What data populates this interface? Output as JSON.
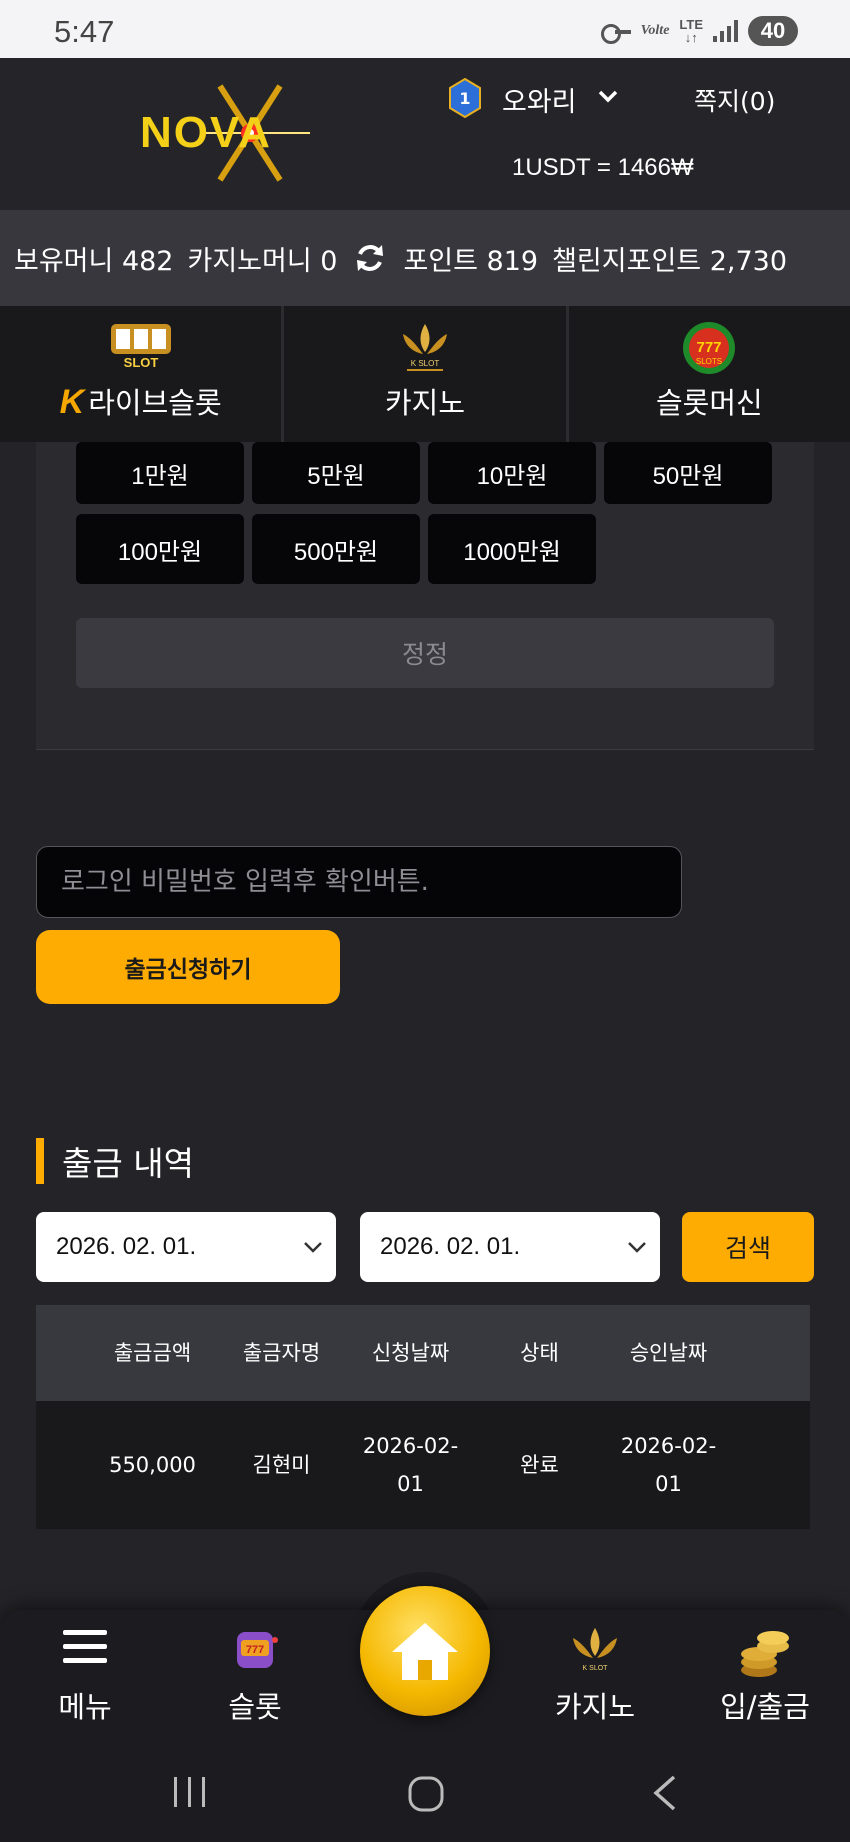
{
  "status_bar": {
    "time": "5:47",
    "volte": "Volte",
    "lte": "LTE",
    "battery": "40"
  },
  "header": {
    "logo": "NOVA",
    "level": "1",
    "username": "오와리",
    "messages": "쪽지(0)",
    "rate": "1USDT = 1466₩"
  },
  "balances": {
    "money": "보유머니 482",
    "casino_money": "카지노머니 0",
    "points": "포인트 819",
    "challenge_points": "챌린지포인트 2,730"
  },
  "categories": {
    "live_slot": "라이브슬롯",
    "casino": "카지노",
    "slot_machine": "슬롯머신"
  },
  "amounts": [
    "1만원",
    "5만원",
    "10만원",
    "50만원",
    "100만원",
    "500만원",
    "1000만원"
  ],
  "correct_label": "정정",
  "password": {
    "placeholder": "로그인 비밀번호 입력후 확인버튼.",
    "value": ""
  },
  "withdraw_label": "출금신청하기",
  "history": {
    "title": "출금 내역",
    "date_from": "2026. 02. 01.",
    "date_to": "2026. 02. 01.",
    "search_label": "검색",
    "headers": [
      "출금금액",
      "출금자명",
      "신청날짜",
      "상태",
      "승인날짜"
    ],
    "rows": [
      {
        "amount": "550,000",
        "name": "김현미",
        "request_date": "2026-02-01",
        "request_date_l1": "2026-02-",
        "request_date_l2": "01",
        "status": "완료",
        "approve_date": "2026-02-01",
        "approve_date_l1": "2026-02-",
        "approve_date_l2": "01"
      }
    ]
  },
  "bottom_nav": {
    "menu": "메뉴",
    "slot": "슬롯",
    "casino": "카지노",
    "deposit_withdraw": "입/출금"
  },
  "colors": {
    "accent": "#ffac02",
    "background": "#242428",
    "panel": "#2a2a2f"
  }
}
